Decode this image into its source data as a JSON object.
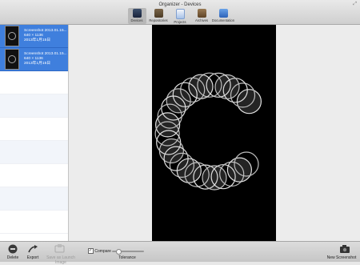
{
  "window": {
    "title": "Organizer - Devices"
  },
  "toolbar": {
    "items": [
      {
        "label": "Devices",
        "icon": "devices-icon",
        "active": true
      },
      {
        "label": "Repositories",
        "icon": "repositories-icon"
      },
      {
        "label": "Projects",
        "icon": "projects-icon"
      },
      {
        "label": "Archives",
        "icon": "archives-icon"
      },
      {
        "label": "Documentation",
        "icon": "documentation-icon"
      }
    ]
  },
  "sidebar": {
    "items": [
      {
        "name": "Screenshot 2013.01.15...",
        "resolution": "640 × 1136",
        "date": "2013年1月15日"
      },
      {
        "name": "Screenshot 2013.01.15...",
        "resolution": "640 × 1136",
        "date": "2013年1月15日"
      }
    ]
  },
  "bottombar": {
    "delete_label": "Delete",
    "export_label": "Export",
    "launch_label": "Save as Launch Image",
    "compare_label": "Compare",
    "tolerance_label": "Tolerance",
    "new_screenshot_label": "New Screenshot"
  },
  "colors": {
    "selection": "#3f7fdd",
    "canvas": "#000000"
  }
}
